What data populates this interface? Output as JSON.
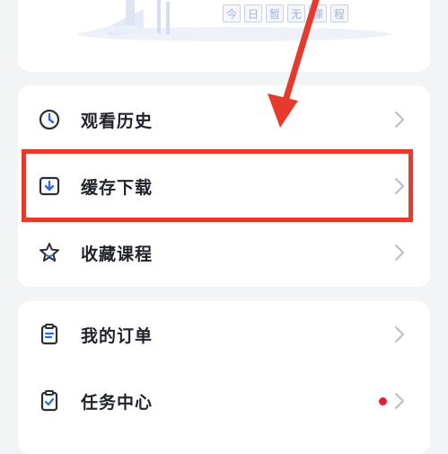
{
  "empty_state": {
    "chars": [
      "今",
      "日",
      "暂",
      "无",
      "课",
      "程"
    ]
  },
  "menu_group_1": [
    {
      "label": "观看历史",
      "icon": "clock-history-icon"
    },
    {
      "label": "缓存下载",
      "icon": "download-icon"
    },
    {
      "label": "收藏课程",
      "icon": "star-icon"
    }
  ],
  "menu_group_2": [
    {
      "label": "我的订单",
      "icon": "clipboard-icon"
    },
    {
      "label": "任务中心",
      "icon": "task-check-icon",
      "badge": true
    }
  ],
  "colors": {
    "annotation_red": "#e53a2c",
    "badge_red": "#e0213a",
    "icon_blue": "#2f6bd6",
    "chevron_gray": "#b8bcc4"
  }
}
